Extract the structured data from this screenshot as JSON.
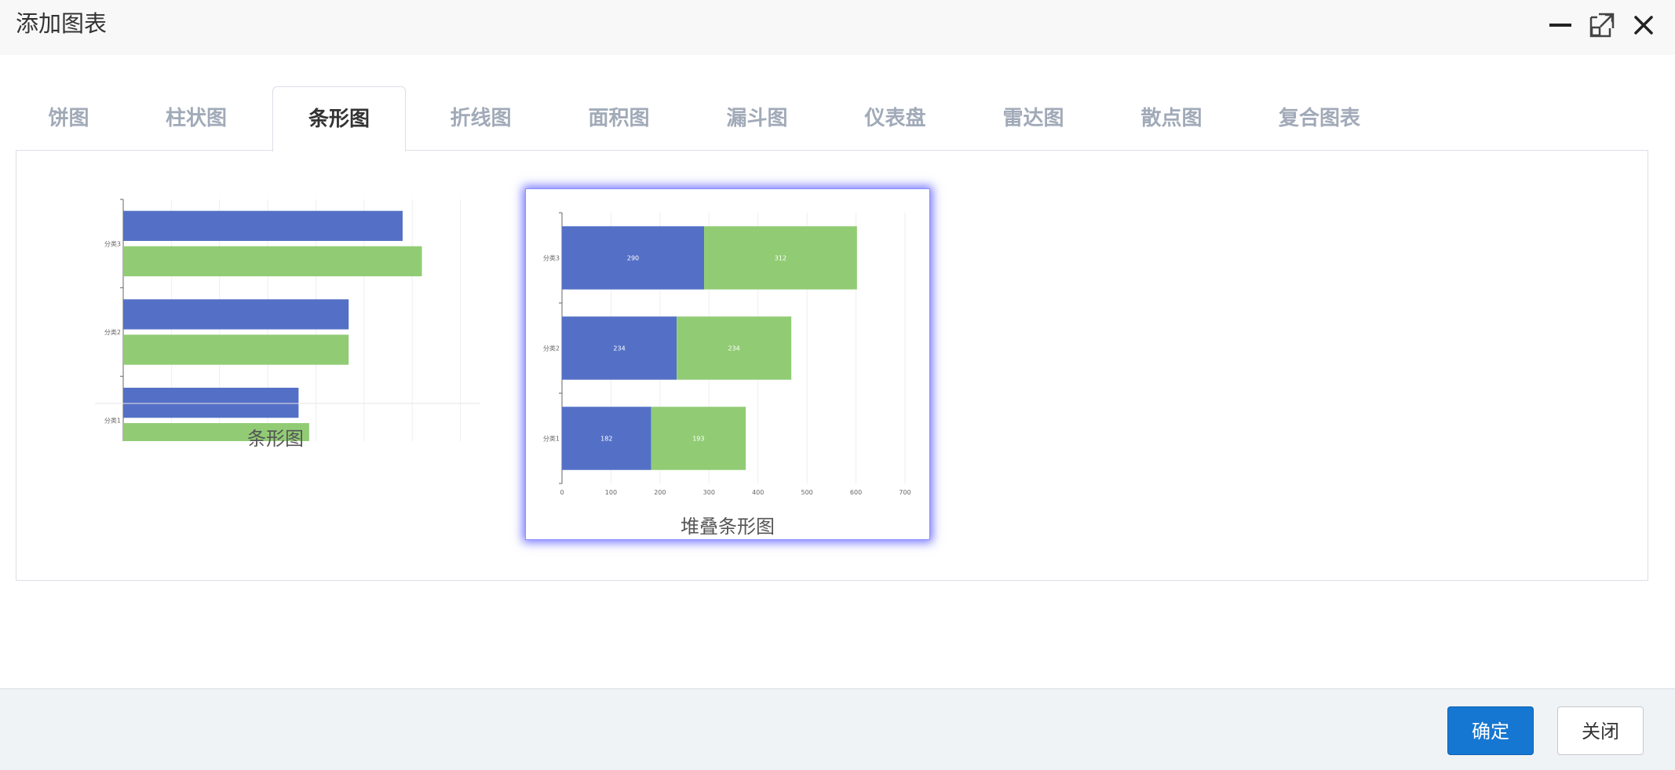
{
  "dialog": {
    "title": "添加图表"
  },
  "window_controls": {
    "minimize_icon": "minimize-icon",
    "maximize_icon": "maximize-icon",
    "close_icon": "close-icon"
  },
  "tabs": [
    {
      "label": "饼图",
      "active": false
    },
    {
      "label": "柱状图",
      "active": false
    },
    {
      "label": "条形图",
      "active": true
    },
    {
      "label": "折线图",
      "active": false
    },
    {
      "label": "面积图",
      "active": false
    },
    {
      "label": "漏斗图",
      "active": false
    },
    {
      "label": "仪表盘",
      "active": false
    },
    {
      "label": "雷达图",
      "active": false
    },
    {
      "label": "散点图",
      "active": false
    },
    {
      "label": "复合图表",
      "active": false
    }
  ],
  "cards": [
    {
      "label": "条形图",
      "selected": false
    },
    {
      "label": "堆叠条形图",
      "selected": true
    }
  ],
  "chart_data": [
    {
      "type": "bar",
      "orientation": "horizontal",
      "categories": [
        "分类1",
        "分类2",
        "分类3"
      ],
      "series": [
        {
          "values": [
            182,
            234,
            290
          ],
          "color": "#5470c6"
        },
        {
          "values": [
            193,
            234,
            310
          ],
          "color": "#91cc75"
        }
      ],
      "xticks": [
        0,
        50,
        100,
        150,
        200,
        250,
        300,
        350
      ],
      "xlim": [
        0,
        365
      ],
      "grid": true,
      "title": ""
    },
    {
      "type": "bar",
      "orientation": "horizontal",
      "stacked": true,
      "categories": [
        "分类1",
        "分类2",
        "分类3"
      ],
      "series": [
        {
          "values": [
            182,
            234,
            290
          ],
          "color": "#5470c6"
        },
        {
          "values": [
            193,
            234,
            312
          ],
          "color": "#91cc75"
        }
      ],
      "xticks": [
        0,
        100,
        200,
        300,
        400,
        500,
        600,
        700
      ],
      "xlim": [
        0,
        700
      ],
      "grid": true,
      "data_labels": true,
      "title": ""
    }
  ],
  "footer": {
    "confirm_label": "确定",
    "close_label": "关闭"
  }
}
